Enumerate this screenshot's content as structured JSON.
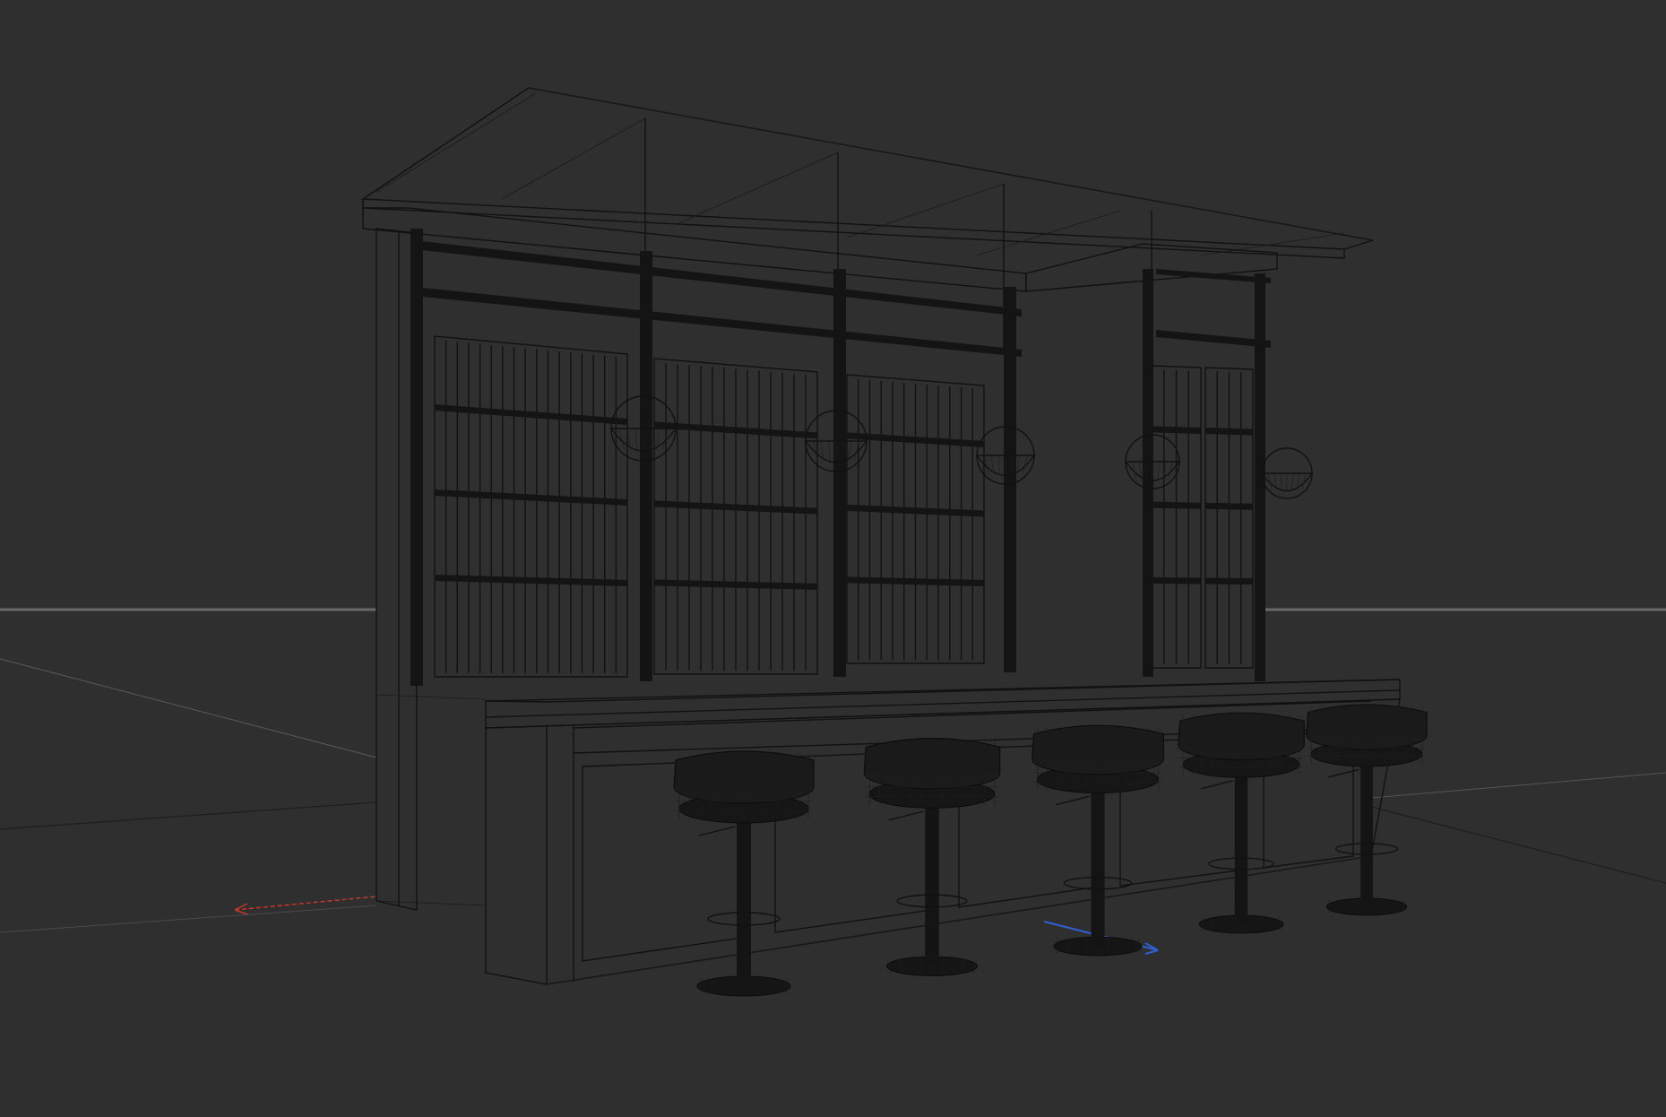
{
  "viewport": {
    "shading_mode": "wireframe",
    "background": "#2f2f2f",
    "wire_color": "#111111",
    "grid_color": "#6a6a6a",
    "x_axis_color": "#c0392b",
    "z_axis_color": "#2f5fd0"
  },
  "scene": {
    "bar_stools": 5,
    "pendant_lamps": 5,
    "cabinet_bays": 5
  }
}
